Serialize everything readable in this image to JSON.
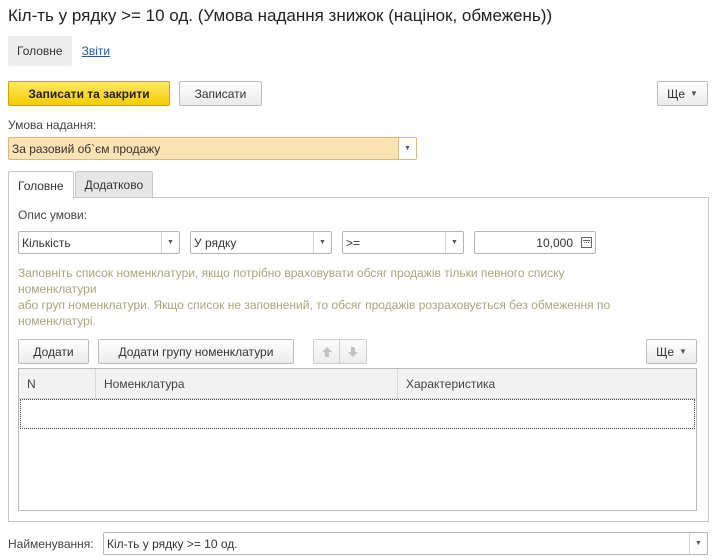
{
  "window": {
    "title": "Кіл-ть у рядку >= 10 од. (Умова надання знижок (націнок, обмежень))"
  },
  "nav": {
    "main_label": "Головне",
    "reports_label": "Звіти"
  },
  "toolbar": {
    "save_close_label": "Записати та закрити",
    "save_label": "Записати",
    "more_label": "Ще"
  },
  "condition": {
    "label": "Умова надання:",
    "value": "За разовий об`єм продажу"
  },
  "tabs": [
    {
      "label": "Головне",
      "active": true
    },
    {
      "label": "Додатково",
      "active": false
    }
  ],
  "main_tab": {
    "description_label": "Опис умови:",
    "quantity_field": "Кількість",
    "scope_field": "У рядку",
    "operator_field": ">=",
    "amount_field": "10,000",
    "hint_lines": [
      "Заповніть список номенклатури, якщо потрібно враховувати обсяг продажів тільки певного списку",
      "номенклатури",
      "або груп номенклатури. Якщо список не заповнений, то обсяг продажів розраховується без обмеження по",
      "номенклатурі."
    ],
    "add_label": "Додати",
    "add_group_label": "Додати групу номенклатури",
    "list_more_label": "Ще",
    "columns": [
      "N",
      "Номенклатура",
      "Характеристика"
    ]
  },
  "footer": {
    "name_label": "Найменування:",
    "name_value": "Кіл-ть у рядку >= 10 од."
  },
  "colors": {
    "primary_button": "#f5cc00",
    "highlight_field": "#fbe3b3",
    "link": "#1d5dab",
    "hint_text": "#a8a57c"
  }
}
